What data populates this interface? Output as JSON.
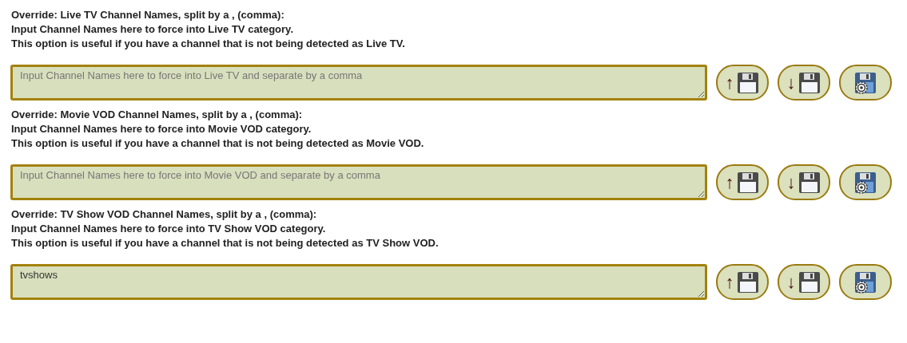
{
  "sections": [
    {
      "lines": [
        "Override: Live TV Channel Names, split by a , (comma):",
        "Input Channel Names here to force into Live TV category.",
        "This option is useful if you have a channel that is not being detected as Live TV."
      ],
      "field": {
        "placeholder": "Input Channel Names here to force into Live TV and separate by a comma"
      },
      "buttons": [
        {
          "kind": "load",
          "arrow": "↑"
        },
        {
          "kind": "save",
          "arrow": "↓"
        },
        {
          "kind": "settings"
        }
      ]
    },
    {
      "lines": [
        "Override: Movie VOD Channel Names, split by a , (comma):",
        "Input Channel Names here to force into Movie VOD category.",
        "This option is useful if you have a channel that is not being detected as Movie VOD."
      ],
      "field": {
        "placeholder": "Input Channel Names here to force into Movie VOD and separate by a comma"
      },
      "buttons": [
        {
          "kind": "load",
          "arrow": "↑"
        },
        {
          "kind": "save",
          "arrow": "↓"
        },
        {
          "kind": "settings"
        }
      ]
    },
    {
      "lines": [
        "Override: TV Show VOD Channel Names, split by a , (comma):",
        "Input Channel Names here to force into TV Show VOD category.",
        "This option is useful if you have a channel that is not being detected as TV Show VOD."
      ],
      "field": {
        "value": "tvshows"
      },
      "buttons": [
        {
          "kind": "load",
          "arrow": "↑"
        },
        {
          "kind": "save",
          "arrow": "↓"
        },
        {
          "kind": "settings"
        }
      ]
    }
  ]
}
